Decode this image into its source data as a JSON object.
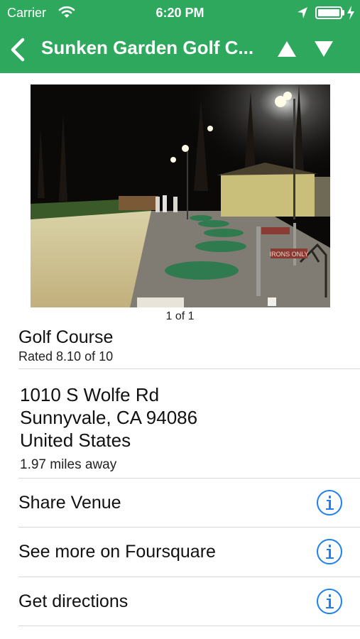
{
  "status_bar": {
    "carrier": "Carrier",
    "time": "6:20 PM",
    "icons": [
      "wifi-icon",
      "location-arrow-icon",
      "battery-icon",
      "charging-bolt-icon"
    ]
  },
  "nav": {
    "title": "Sunken Garden Golf C...",
    "back_icon": "chevron-left-icon",
    "prev_icon": "triangle-up-icon",
    "next_icon": "triangle-down-icon",
    "bar_color": "#2ea85c"
  },
  "photo": {
    "counter": "1 of 1",
    "sign_text": "IRONS ONLY"
  },
  "venue": {
    "category": "Golf Course",
    "rating": "Rated 8.10 of 10",
    "address_line1": "1010 S Wolfe Rd",
    "address_line2": "Sunnyvale, CA 94086",
    "address_line3": "United States",
    "distance": "1.97 miles away"
  },
  "actions": [
    {
      "label": "Share Venue",
      "icon": "info-icon"
    },
    {
      "label": "See more on Foursquare",
      "icon": "info-icon"
    },
    {
      "label": "Get directions",
      "icon": "info-icon"
    }
  ],
  "colors": {
    "accent": "#1e7ff2",
    "separator": "#d8d8d8"
  }
}
